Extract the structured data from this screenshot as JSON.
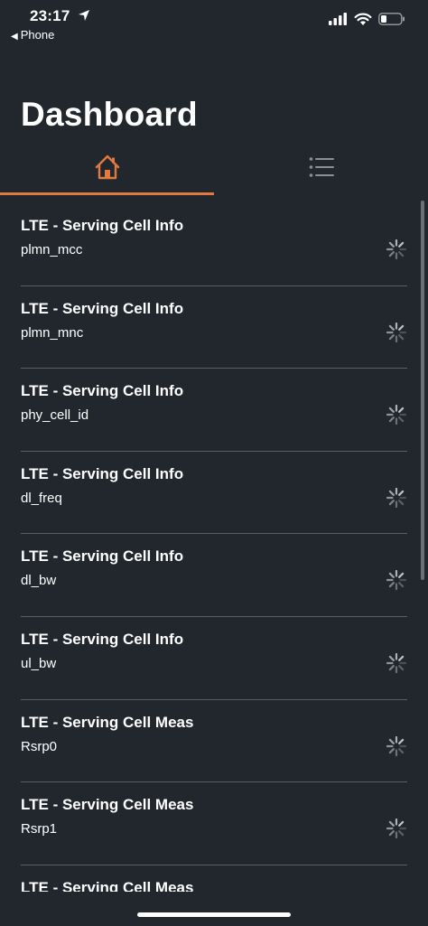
{
  "status_bar": {
    "time": "23:17",
    "back_app": "Phone"
  },
  "header": {
    "title": "Dashboard"
  },
  "tabs": [
    {
      "icon": "home-icon",
      "active": true
    },
    {
      "icon": "list-icon",
      "active": false
    }
  ],
  "items": [
    {
      "title": "LTE - Serving Cell Info",
      "subtitle": "plmn_mcc"
    },
    {
      "title": "LTE - Serving Cell Info",
      "subtitle": "plmn_mnc"
    },
    {
      "title": "LTE - Serving Cell Info",
      "subtitle": "phy_cell_id"
    },
    {
      "title": "LTE - Serving Cell Info",
      "subtitle": "dl_freq"
    },
    {
      "title": "LTE - Serving Cell Info",
      "subtitle": "dl_bw"
    },
    {
      "title": "LTE - Serving Cell Info",
      "subtitle": "ul_bw"
    },
    {
      "title": "LTE - Serving Cell Meas",
      "subtitle": "Rsrp0"
    },
    {
      "title": "LTE - Serving Cell Meas",
      "subtitle": "Rsrp1"
    },
    {
      "title": "LTE - Serving Cell Meas",
      "subtitle": ""
    }
  ],
  "colors": {
    "background": "#22272e",
    "accent": "#e07a3f",
    "divider": "#5a5f66",
    "inactive_icon": "#8a8f96"
  }
}
